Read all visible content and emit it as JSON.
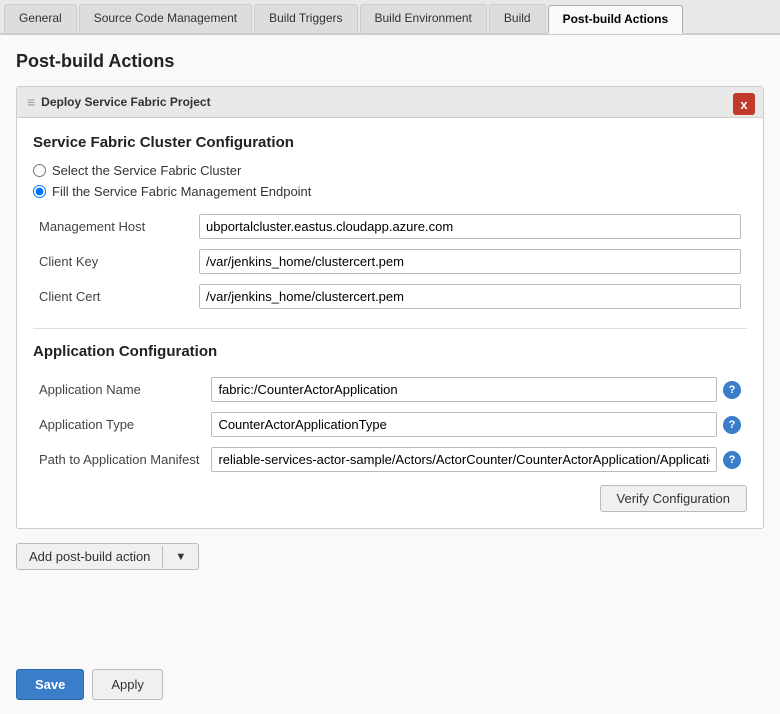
{
  "tabs": [
    {
      "label": "General",
      "active": false
    },
    {
      "label": "Source Code Management",
      "active": false
    },
    {
      "label": "Build Triggers",
      "active": false
    },
    {
      "label": "Build Environment",
      "active": false
    },
    {
      "label": "Build",
      "active": false
    },
    {
      "label": "Post-build Actions",
      "active": true
    }
  ],
  "page_title": "Post-build Actions",
  "deploy_section": {
    "header": "Deploy Service Fabric Project",
    "close_label": "x",
    "cluster_config": {
      "title": "Service Fabric Cluster Configuration",
      "radio_option1": "Select the Service Fabric Cluster",
      "radio_option2": "Fill the Service Fabric Management Endpoint",
      "fields": [
        {
          "label": "Management Host",
          "value": "ubportalcluster.eastus.cloudapp.azure.com",
          "has_help": false
        },
        {
          "label": "Client Key",
          "value": "/var/jenkins_home/clustercert.pem",
          "has_help": false
        },
        {
          "label": "Client Cert",
          "value": "/var/jenkins_home/clustercert.pem",
          "has_help": false
        }
      ]
    },
    "app_config": {
      "title": "Application Configuration",
      "fields": [
        {
          "label": "Application Name",
          "value": "fabric:/CounterActorApplication",
          "has_help": true
        },
        {
          "label": "Application Type",
          "value": "CounterActorApplicationType",
          "has_help": true
        },
        {
          "label": "Path to Application Manifest",
          "value": "reliable-services-actor-sample/Actors/ActorCounter/CounterActorApplication/ApplicationManifes",
          "has_help": true
        }
      ],
      "verify_btn": "Verify Configuration"
    }
  },
  "add_action": {
    "label": "Add post-build action",
    "dropdown_icon": "▼"
  },
  "footer": {
    "save_label": "Save",
    "apply_label": "Apply"
  }
}
